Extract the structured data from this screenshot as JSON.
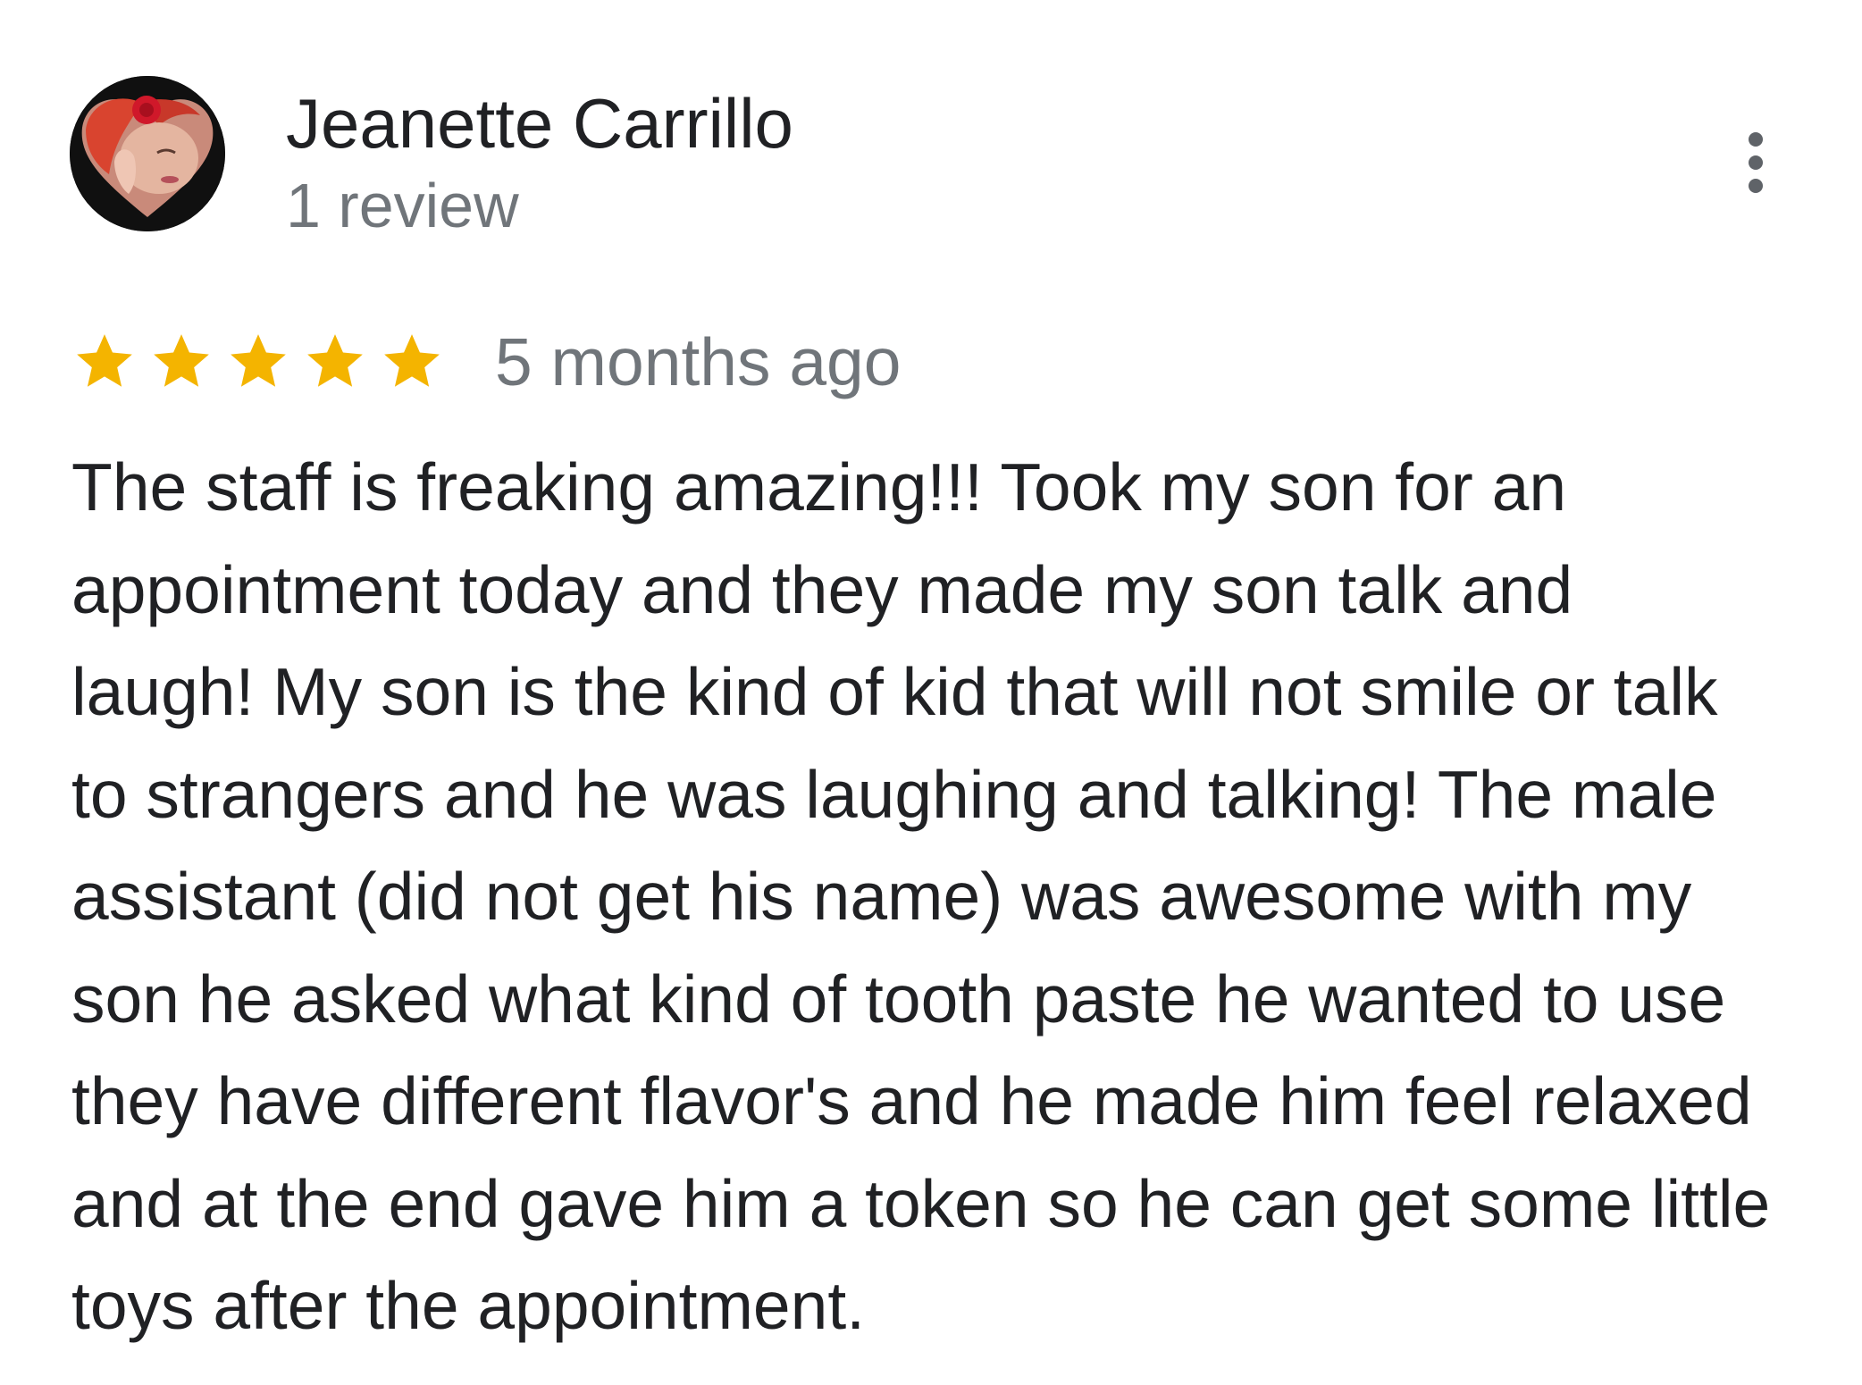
{
  "review": {
    "author": {
      "name": "Jeanette Carrillo",
      "meta": "1 review",
      "avatar_icon": "profile-photo"
    },
    "menu_icon": "more-vert-icon",
    "rating": {
      "value": 5,
      "max": 5,
      "star_color": "#f4b400"
    },
    "time_ago": "5 months ago",
    "text_lines": [
      "The staff is freaking amazing!!! Took my son for an",
      "appointment today and they made my son talk and",
      "laugh! My son is the kind of kid that will not smile or talk",
      "to strangers and he was laughing and talking! The male",
      "assistant (did not get his name) was awesome with my",
      "son he asked what kind of tooth paste he wanted to use",
      "they have different flavor's and he made him feel relaxed",
      "and at the end gave him a token so he can get some little",
      "toys after the appointment."
    ]
  },
  "colors": {
    "text_primary": "#202124",
    "text_secondary": "#70757a",
    "icon": "#5f6368",
    "background": "#ffffff"
  }
}
